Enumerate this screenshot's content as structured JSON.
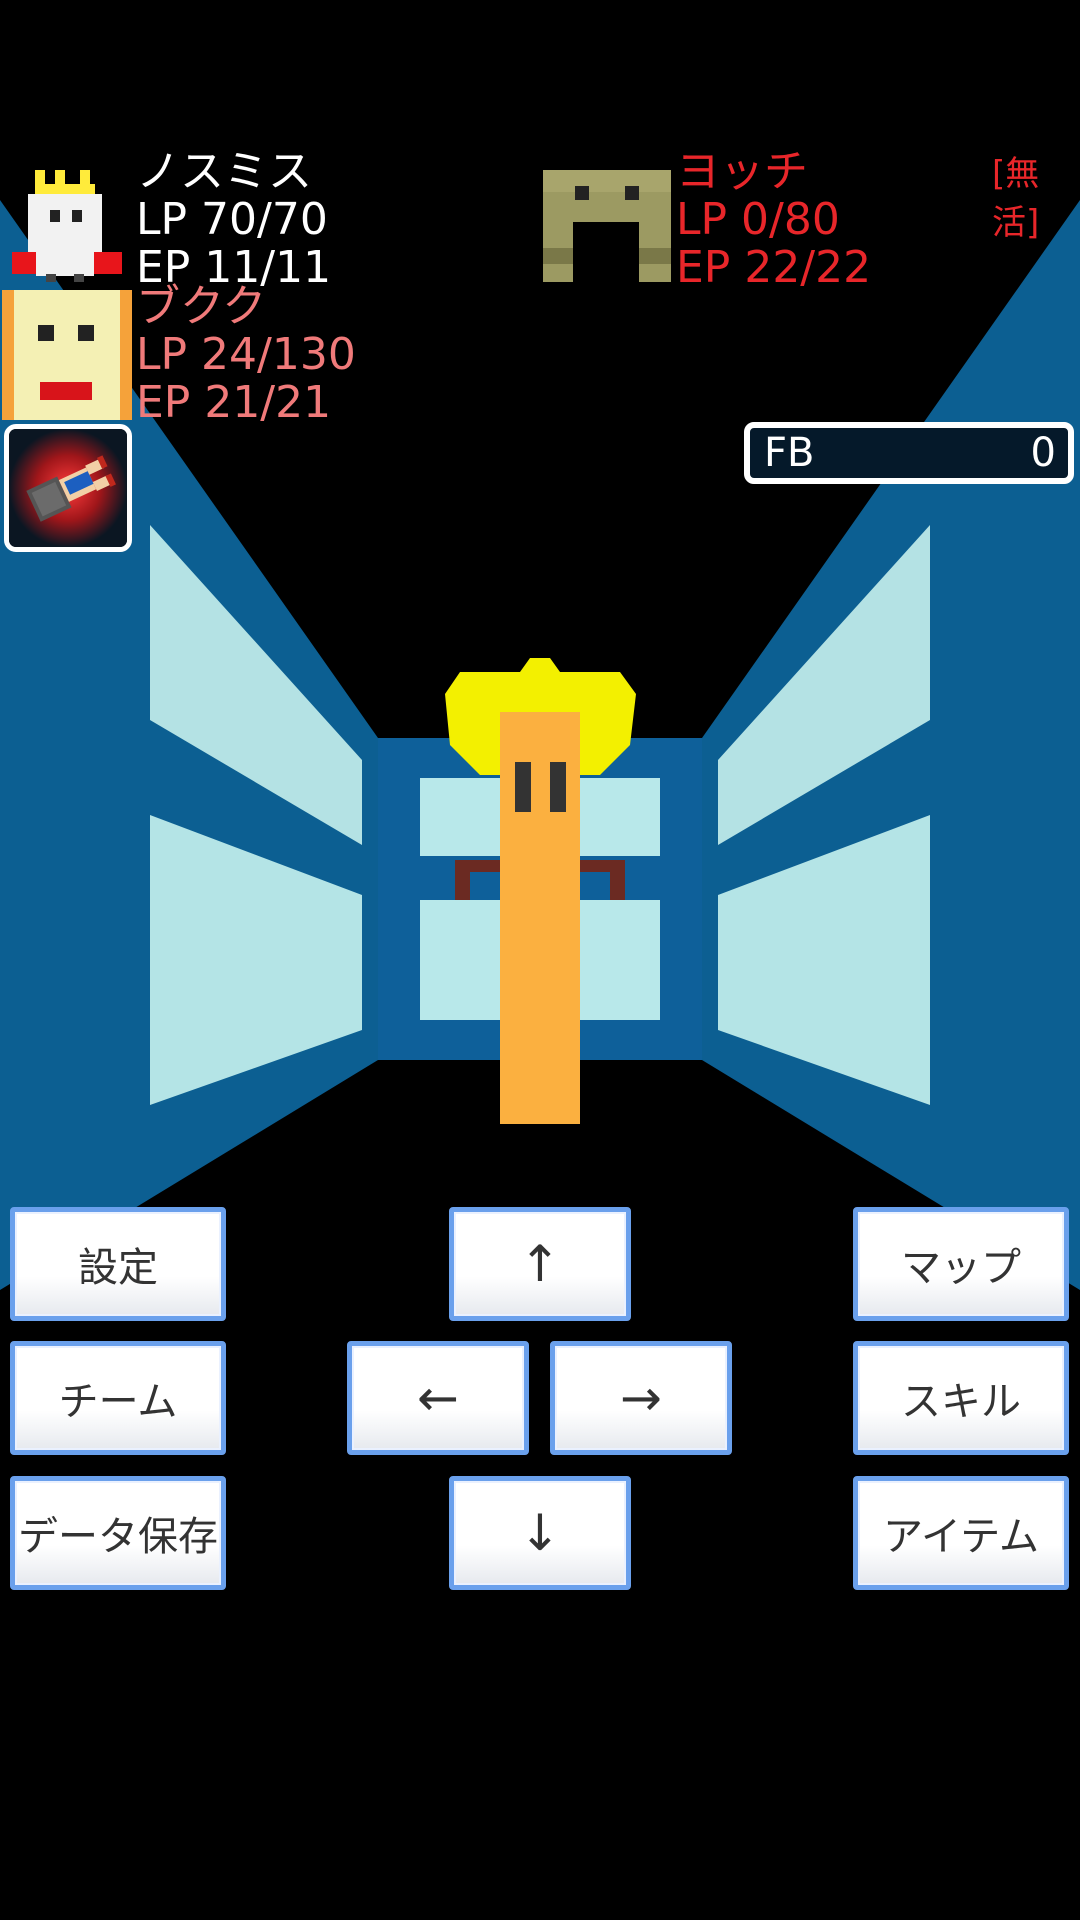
{
  "party": [
    {
      "name": "ノスミス",
      "lp": "LP 70/70",
      "ep": "EP 11/11"
    },
    {
      "name": "ブクク",
      "lp": "LP 24/130",
      "ep": "EP 21/21"
    }
  ],
  "enemy": {
    "name": "ヨッチ",
    "lp": "LP 0/80",
    "ep": "EP 22/22",
    "status": "[無活]"
  },
  "fb": {
    "label": "FB",
    "value": "0"
  },
  "buttons": {
    "settings": "設定",
    "team": "チーム",
    "save": "データ保存",
    "map": "マップ",
    "skill": "スキル",
    "item": "アイテム",
    "up": "↑",
    "down": "↓",
    "left": "←",
    "right": "→"
  },
  "colors": {
    "wall": "#0c5f92",
    "window": "#b4e4e6",
    "player_text": "#ffffff",
    "hurt_text": "#f07a7a",
    "enemy_text": "#e8262a",
    "button_border": "#6aa0ec"
  },
  "icons": {
    "player1": "crowned-ghost-portrait",
    "player2": "bread-face-portrait",
    "enemy": "arch-monster-portrait",
    "skill_slot": "fallen-character-icon"
  }
}
